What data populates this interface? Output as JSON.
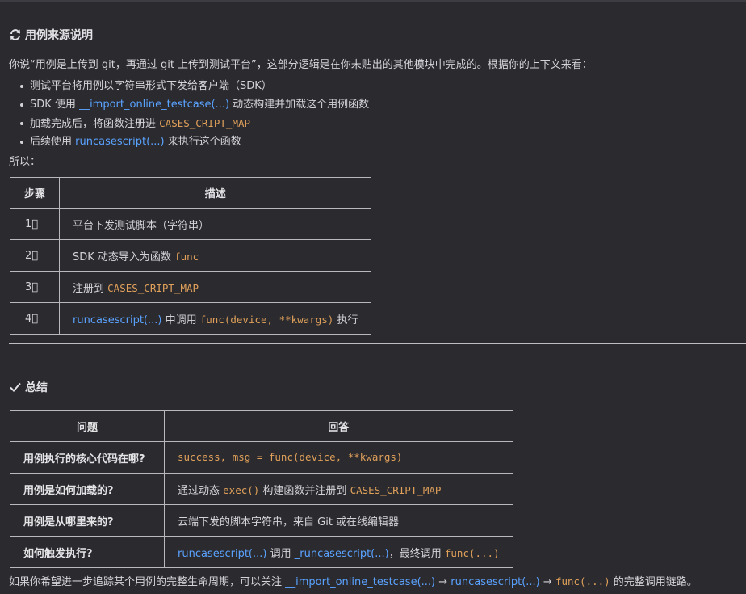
{
  "section1": {
    "title": "用例来源说明",
    "intro": "你说“用例是上传到 git，再通过 git 上传到测试平台”，这部分逻辑是在你未贴出的其他模块中完成的。根据你的上下文来看：",
    "bullets": [
      {
        "a": "测试平台将用例以字符串形式下发给客户端（SDK）"
      },
      {
        "a": "SDK 使用 ",
        "link": "__import_online_testcase(...)",
        "b": " 动态构建并加载这个用例函数"
      },
      {
        "a": "加载完成后，将函数注册进 ",
        "code": "CASES_CRIPT_MAP"
      },
      {
        "a": "后续使用 ",
        "link": "runcasescript(...)",
        "b": " 来执行这个函数"
      }
    ],
    "so": "所以："
  },
  "table1": {
    "headers": [
      "步骤",
      "描述"
    ],
    "rows": [
      {
        "step": "1⃣",
        "a": "平台下发测试脚本（字符串）"
      },
      {
        "step": "2⃣",
        "a": "SDK 动态导入为函数 ",
        "code": "func"
      },
      {
        "step": "3⃣",
        "a": "注册到 ",
        "code": "CASES_CRIPT_MAP"
      },
      {
        "step": "4⃣",
        "link": "runcasescript(...)",
        "a": " 中调用 ",
        "code": "func(device, **kwargs)",
        "b": " 执行"
      }
    ]
  },
  "section2": {
    "title": "总结"
  },
  "table2": {
    "headers": [
      "问题",
      "回答"
    ],
    "rows": [
      {
        "q": "用例执行的核心代码在哪?",
        "code": "success, msg = func(device, **kwargs)"
      },
      {
        "q": "用例是如何加载的?",
        "a": "通过动态 ",
        "code1": "exec()",
        "b": " 构建函数并注册到 ",
        "code2": "CASES_CRIPT_MAP"
      },
      {
        "q": "用例是从哪里来的?",
        "a": "云端下发的脚本字符串，来自 Git 或在线编辑器"
      },
      {
        "q": "如何触发执行?",
        "link1": "runcasescript(...)",
        "a": " 调用 ",
        "link2": "_runcasescript(...)",
        "b": "，最终调用 ",
        "code": "func(...)"
      }
    ]
  },
  "footer": {
    "a": "如果你希望进一步追踪某个用例的完整生命周期，可以关注 ",
    "link1": "__import_online_testcase(...)",
    "arrow1": " → ",
    "link2": "runcasescript(...)",
    "arrow2": " → ",
    "code": "func(...)",
    "b": " 的完整调用链路。"
  },
  "icons": {
    "section1": "refresh-icon",
    "section2": "check-icon"
  },
  "colors": {
    "background": "#2b2b2f",
    "link": "#5aa2ff",
    "code": "#e0a05a",
    "text": "#d4d4d8"
  }
}
